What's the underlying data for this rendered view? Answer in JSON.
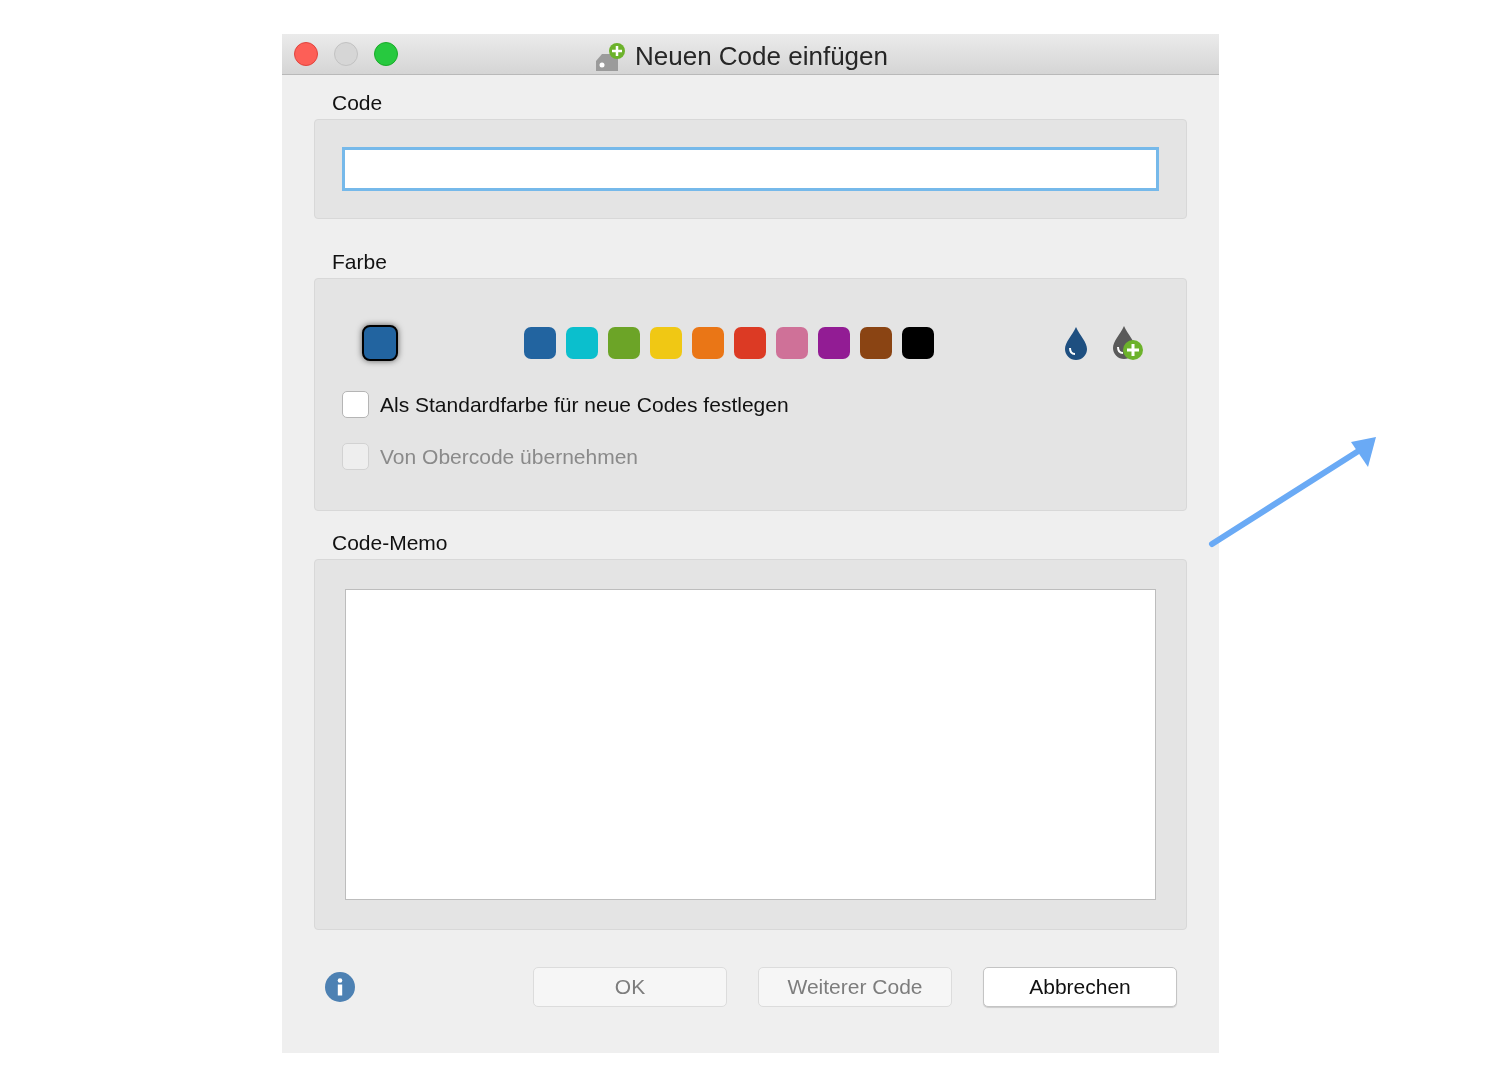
{
  "window": {
    "title": "Neuen Code einfügen"
  },
  "code": {
    "label": "Code"
  },
  "color": {
    "label": "Farbe",
    "current": {
      "color": "#2264a0"
    },
    "swatches": [
      {
        "color": "#2264a0"
      },
      {
        "color": "#0bbfcd"
      },
      {
        "color": "#6ca427"
      },
      {
        "color": "#f0c814"
      },
      {
        "color": "#ea7616"
      },
      {
        "color": "#dc3a24"
      },
      {
        "color": "#cf7198"
      },
      {
        "color": "#921c94"
      },
      {
        "color": "#8a4413"
      },
      {
        "color": "#000000"
      }
    ],
    "options": [
      {
        "label": "Als Standardfarbe für neue Codes festlegen",
        "checked": false,
        "disabled": false
      },
      {
        "label": "Von Obercode übernehmen",
        "checked": false,
        "disabled": true
      }
    ]
  },
  "memo": {
    "label": "Code-Memo"
  },
  "buttons": [
    {
      "label": "OK",
      "disabled": true
    },
    {
      "label": "Weiterer Code",
      "disabled": true
    },
    {
      "label": "Abbrechen",
      "disabled": false
    }
  ]
}
